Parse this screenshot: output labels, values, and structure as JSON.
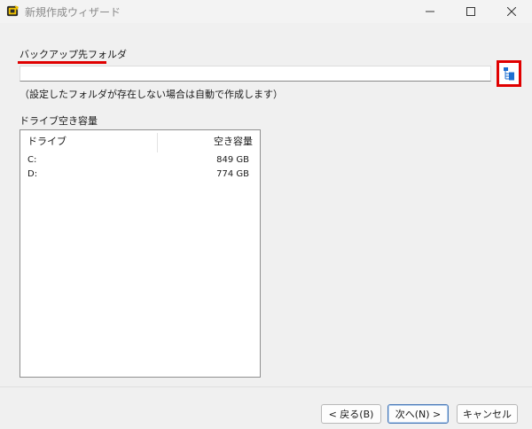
{
  "window": {
    "title": "新規作成ウィザード",
    "minimize_icon": "minimize-icon",
    "maximize_icon": "maximize-icon",
    "close_icon": "close-icon"
  },
  "form": {
    "backup_folder_label": "バックアップ先フォルダ",
    "backup_folder_value": "",
    "browse_icon": "folder-tree-icon",
    "hint": "（設定したフォルダが存在しない場合は自動で作成します）"
  },
  "drive_space": {
    "label": "ドライブ空き容量",
    "columns": [
      "ドライブ",
      "空き容量"
    ],
    "rows": [
      {
        "drive": "C:",
        "free": "849 GB"
      },
      {
        "drive": "D:",
        "free": "774 GB"
      }
    ]
  },
  "footer": {
    "back_label": "< 戻る(B)",
    "next_label": "次へ(N) >",
    "cancel_label": "キャンセル"
  },
  "colors": {
    "highlight": "#e00000",
    "focus_border": "#4a7ab8"
  }
}
